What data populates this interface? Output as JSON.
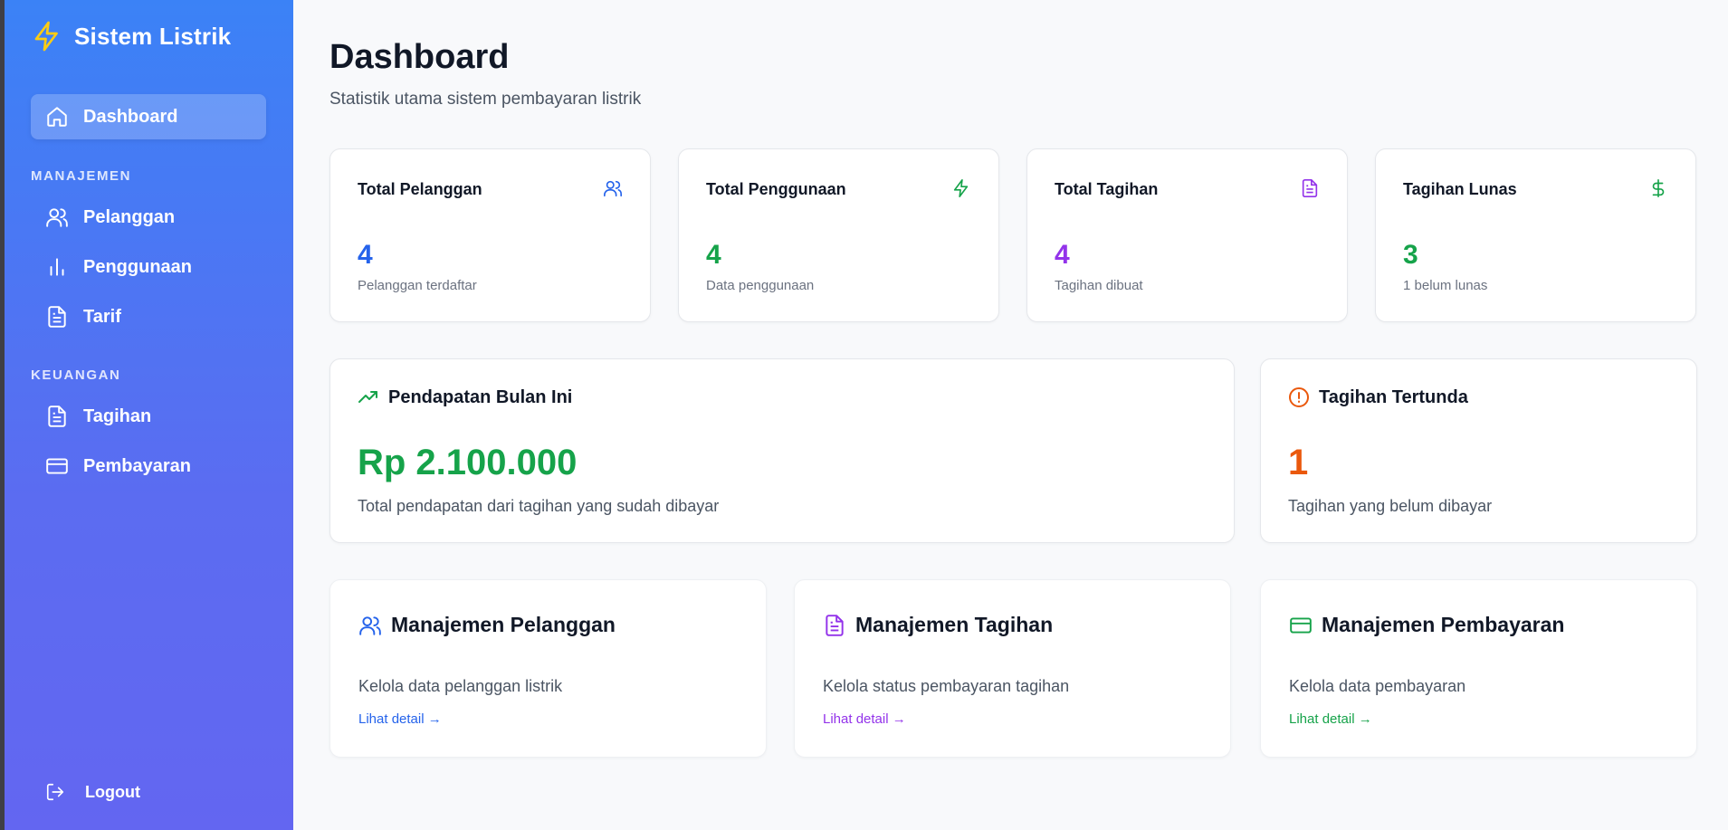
{
  "colors": {
    "blue": "#2563eb",
    "green": "#16a34a",
    "purple": "#9333ea",
    "orange": "#ea580c",
    "sidebar_top": "#3b82f6",
    "sidebar_bottom": "#6366f1",
    "brand_icon": "#facc15"
  },
  "sidebar": {
    "brand": {
      "icon": "lightning-icon",
      "title": "Sistem Listrik"
    },
    "dashboard": {
      "label": "Dashboard",
      "icon": "home-icon"
    },
    "sections": [
      {
        "label": "MANAJEMEN",
        "items": [
          {
            "label": "Pelanggan",
            "icon": "users-icon"
          },
          {
            "label": "Penggunaan",
            "icon": "bar-chart-icon"
          },
          {
            "label": "Tarif",
            "icon": "document-icon"
          }
        ]
      },
      {
        "label": "KEUANGAN",
        "items": [
          {
            "label": "Tagihan",
            "icon": "document-icon"
          },
          {
            "label": "Pembayaran",
            "icon": "credit-card-icon"
          }
        ]
      }
    ],
    "logout": {
      "label": "Logout",
      "icon": "logout-icon"
    }
  },
  "header": {
    "title": "Dashboard",
    "subtitle": "Statistik utama sistem pembayaran listrik"
  },
  "stats": [
    {
      "label": "Total Pelanggan",
      "value": "4",
      "desc": "Pelanggan terdaftar",
      "icon": "users-icon",
      "color": "#2563eb"
    },
    {
      "label": "Total Penggunaan",
      "value": "4",
      "desc": "Data penggunaan",
      "icon": "lightning-icon",
      "color": "#16a34a"
    },
    {
      "label": "Total Tagihan",
      "value": "4",
      "desc": "Tagihan dibuat",
      "icon": "document-icon",
      "color": "#9333ea"
    },
    {
      "label": "Tagihan Lunas",
      "value": "3",
      "desc": "1 belum lunas",
      "icon": "dollar-icon",
      "color": "#16a34a"
    }
  ],
  "revenue": {
    "title": "Pendapatan Bulan Ini",
    "value": "Rp 2.100.000",
    "desc": "Total pendapatan dari tagihan yang sudah dibayar",
    "icon": "trending-up-icon"
  },
  "pending": {
    "title": "Tagihan Tertunda",
    "value": "1",
    "desc": "Tagihan yang belum dibayar",
    "icon": "alert-circle-icon"
  },
  "management": [
    {
      "title": "Manajemen Pelanggan",
      "desc": "Kelola data pelanggan listrik",
      "link": "Lihat detail →",
      "icon": "users-icon",
      "color": "#2563eb"
    },
    {
      "title": "Manajemen Tagihan",
      "desc": "Kelola status pembayaran tagihan",
      "link": "Lihat detail →",
      "icon": "document-icon",
      "color": "#9333ea"
    },
    {
      "title": "Manajemen Pembayaran",
      "desc": "Kelola data pembayaran",
      "link": "Lihat detail →",
      "icon": "credit-card-icon",
      "color": "#16a34a"
    }
  ]
}
